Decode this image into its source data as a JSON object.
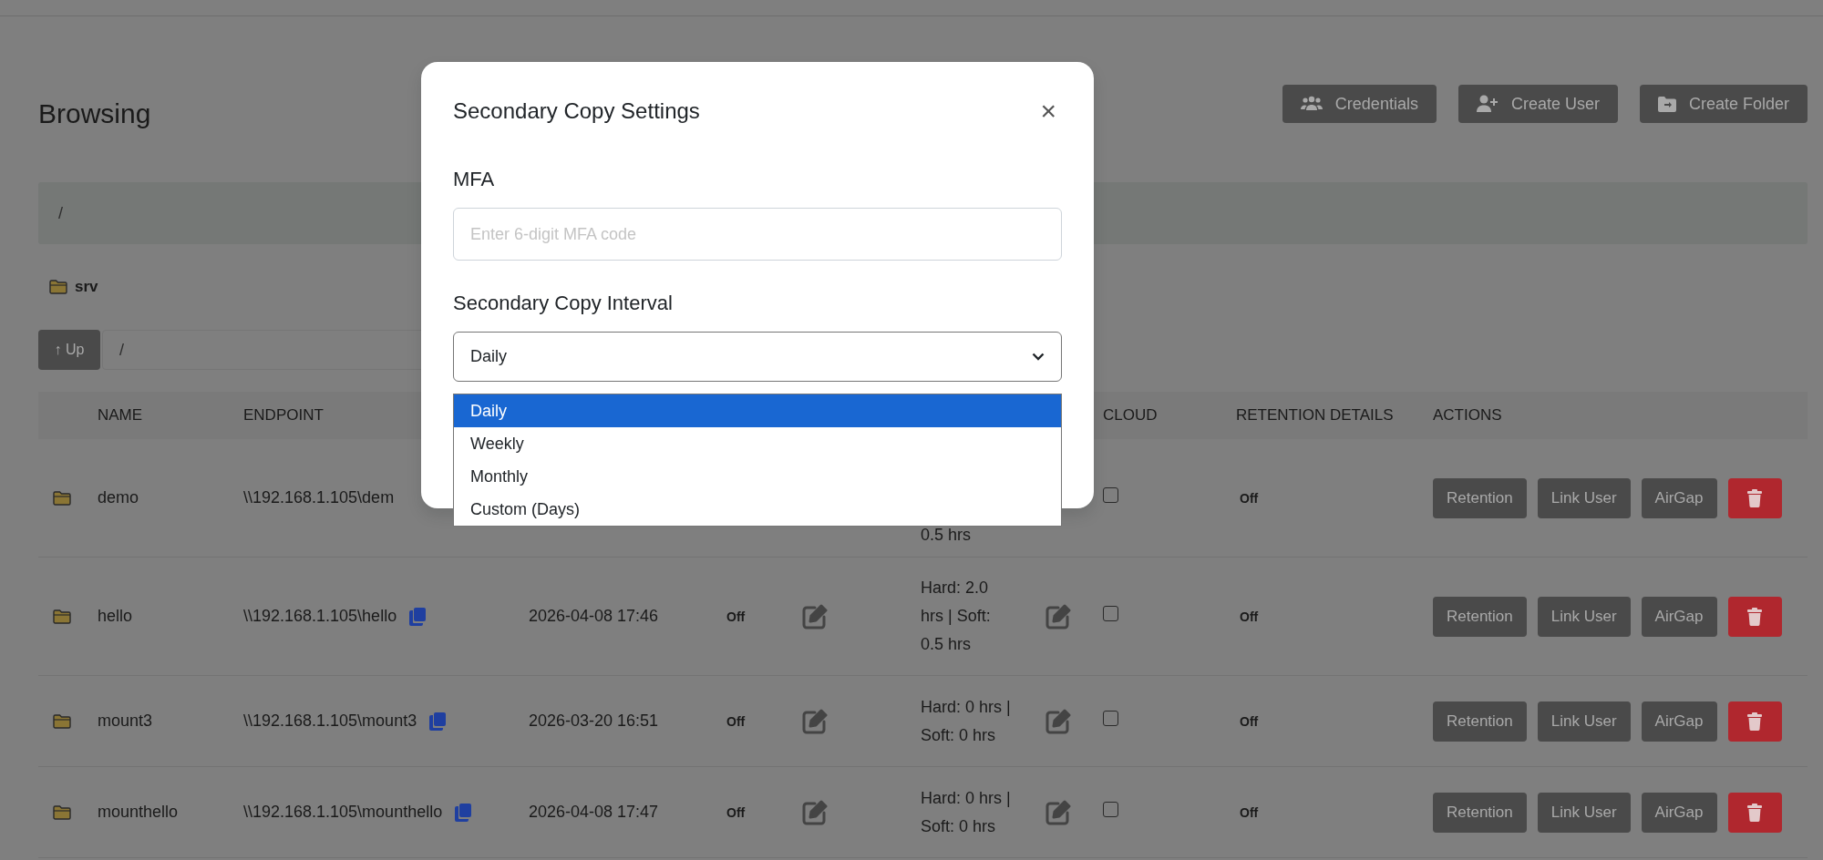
{
  "header": {
    "title": "Browsing",
    "buttons": [
      {
        "label": "Credentials"
      },
      {
        "label": "Create User"
      },
      {
        "label": "Create Folder"
      }
    ]
  },
  "breadcrumb": "/",
  "folders": [
    {
      "label": "srv"
    }
  ],
  "path_bar": {
    "up_label": "↑ Up",
    "value": "/"
  },
  "table": {
    "header": {
      "name": "NAME",
      "endpoint": "ENDPOINT",
      "cloud": "CLOUD",
      "retention_details": "RETENTION DETAILS",
      "actions": "ACTIONS"
    },
    "rows": [
      {
        "name": "demo",
        "endpoint": "\\\\192.168.1.105\\dem",
        "limits": "0.5 hrs",
        "cloud_checked": false,
        "retention": "Off",
        "actions": [
          "Retention",
          "Link User",
          "AirGap"
        ]
      },
      {
        "name": "hello",
        "endpoint": "\\\\192.168.1.105\\hello",
        "modified": "2026-04-08 17:46",
        "status": "Off",
        "limits": "Hard: 2.0 hrs | Soft: 0.5 hrs",
        "cloud_checked": false,
        "retention": "Off",
        "actions": [
          "Retention",
          "Link User",
          "AirGap"
        ]
      },
      {
        "name": "mount3",
        "endpoint": "\\\\192.168.1.105\\mount3",
        "modified": "2026-03-20 16:51",
        "status": "Off",
        "limits": "Hard: 0 hrs | Soft: 0 hrs",
        "cloud_checked": false,
        "retention": "Off",
        "actions": [
          "Retention",
          "Link User",
          "AirGap"
        ]
      },
      {
        "name": "mounthello",
        "endpoint": "\\\\192.168.1.105\\mounthello",
        "modified": "2026-04-08 17:47",
        "status": "Off",
        "limits": "Hard: 0 hrs | Soft: 0 hrs",
        "cloud_checked": false,
        "retention": "Off",
        "actions": [
          "Retention",
          "Link User",
          "AirGap"
        ]
      }
    ]
  },
  "dialog": {
    "title": "Secondary Copy Settings",
    "close": "×",
    "fields": [
      {
        "kind": "input",
        "label": "MFA",
        "placeholder": "Enter 6-digit MFA code"
      },
      {
        "kind": "select",
        "label": "Secondary Copy Interval",
        "value": "Daily",
        "expanded": true,
        "options": [
          {
            "label": "Daily",
            "selected": true
          },
          {
            "label": "Weekly",
            "selected": false
          },
          {
            "label": "Monthly",
            "selected": false
          },
          {
            "label": "Custom (Days)",
            "selected": false
          }
        ]
      }
    ]
  }
}
